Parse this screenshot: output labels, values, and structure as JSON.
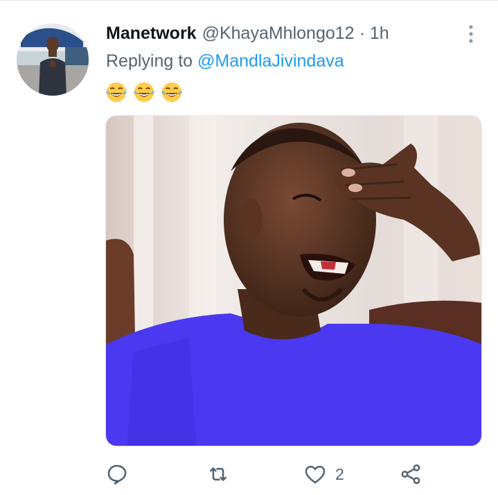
{
  "tweet": {
    "display_name": "Manetwork",
    "handle": "@KhayaMhlongo12",
    "separator": "·",
    "time": "1h",
    "replying_prefix": "Replying to",
    "replying_to": "@MandlaJivindava",
    "emojis": [
      "face-with-tears-of-joy",
      "face-with-tears-of-joy",
      "face-with-tears-of-joy"
    ],
    "media_description_icon": "photo-of-man-laughing-in-purple-shirt"
  },
  "actions": {
    "reply_icon": "reply-icon",
    "retweet_icon": "retweet-icon",
    "like_icon": "heart-icon",
    "like_count": "2",
    "share_icon": "share-icon"
  },
  "colors": {
    "text_primary": "#0f1419",
    "text_secondary": "#536471",
    "link": "#1d9bf0",
    "shirt": "#4a39f0"
  }
}
